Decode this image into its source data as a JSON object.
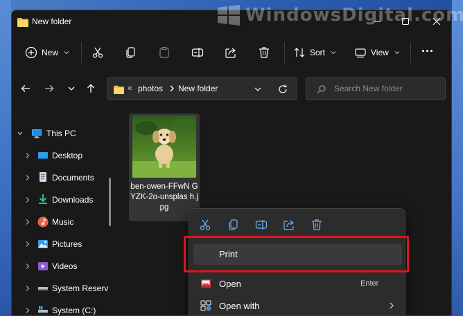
{
  "watermark": {
    "text": "WindowsDigital.com"
  },
  "window": {
    "title": "New folder"
  },
  "commandbar": {
    "new_label": "New",
    "sort_label": "Sort",
    "view_label": "View",
    "more_label": "···"
  },
  "address": {
    "overflow": "«",
    "crumbs": [
      "photos",
      "New folder"
    ]
  },
  "search": {
    "placeholder": "Search New folder"
  },
  "sidebar": {
    "items": [
      {
        "label": "This PC",
        "icon": "monitor-icon"
      },
      {
        "label": "Desktop",
        "icon": "desktop-icon"
      },
      {
        "label": "Documents",
        "icon": "documents-icon"
      },
      {
        "label": "Downloads",
        "icon": "download-icon"
      },
      {
        "label": "Music",
        "icon": "music-icon"
      },
      {
        "label": "Pictures",
        "icon": "pictures-icon"
      },
      {
        "label": "Videos",
        "icon": "videos-icon"
      },
      {
        "label": "System Reserv",
        "icon": "drive-icon"
      },
      {
        "label": "System (C:)",
        "icon": "windows-drive-icon"
      }
    ]
  },
  "files": [
    {
      "name": "ben-owen-FFwNGYZK-2o-unsplash.jpg",
      "display_name": "ben-owen-FFwN GYZK-2o-unsplas h.jpg"
    }
  ],
  "context_menu": {
    "quick_actions": [
      "cut-icon",
      "copy-icon",
      "rename-icon",
      "share-icon",
      "delete-icon"
    ],
    "items": [
      {
        "label": "Print",
        "shortcut": "",
        "icon": ""
      },
      {
        "label": "Open",
        "shortcut": "Enter",
        "icon": "open-icon"
      },
      {
        "label": "Open with",
        "shortcut": "",
        "icon": "open-with-icon",
        "has_submenu": true
      }
    ]
  },
  "colors": {
    "window_bg": "#191919",
    "highlight": "#e0131a",
    "folder_yellow": "#f5c242",
    "accent_blue": "#4aa3f0"
  }
}
